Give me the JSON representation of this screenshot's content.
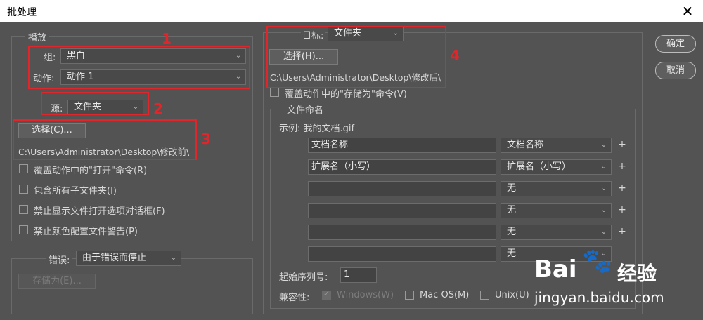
{
  "window": {
    "title": "批处理",
    "close_glyph": "✕"
  },
  "play": {
    "legend": "播放",
    "set_label": "组:",
    "set_value": "黑白",
    "action_label": "动作:",
    "action_value": "动作 1",
    "source_label": "源:",
    "source_value": "文件夹",
    "choose_button": "选择(C)...",
    "source_path": "C:\\Users\\Administrator\\Desktop\\修改前\\",
    "options": [
      "覆盖动作中的\"打开\"命令(R)",
      "包含所有子文件夹(I)",
      "禁止显示文件打开选项对话框(F)",
      "禁止颜色配置文件警告(P)"
    ],
    "errors_label": "错误:",
    "errors_value": "由于错误而停止",
    "save_as_button": "存储为(E)..."
  },
  "destination": {
    "label": "目标:",
    "value": "文件夹",
    "choose_button": "选择(H)...",
    "path": "C:\\Users\\Administrator\\Desktop\\修改后\\",
    "override_save": "覆盖动作中的\"存储为\"命令(V)"
  },
  "naming": {
    "legend": "文件命名",
    "example": "示例: 我的文档.gif",
    "rows": [
      {
        "text": "文档名称",
        "select": "文档名称"
      },
      {
        "text": "扩展名（小写）",
        "select": "扩展名（小写）"
      },
      {
        "text": "",
        "select": "无"
      },
      {
        "text": "",
        "select": "无"
      },
      {
        "text": "",
        "select": "无"
      },
      {
        "text": "",
        "select": "无"
      }
    ],
    "plus_glyph": "+",
    "serial_label": "起始序列号:",
    "serial_value": "1",
    "compat_label": "兼容性:",
    "compat_windows": "Windows(W)",
    "compat_mac": "Mac OS(M)",
    "compat_unix": "Unix(U)"
  },
  "buttons": {
    "ok": "确定",
    "cancel": "取消"
  },
  "annotations": {
    "n1": "1",
    "n2": "2",
    "n3": "3",
    "n4": "4"
  },
  "watermark": {
    "brand": "Bai",
    "brand2": "经验",
    "url": "jingyan.baidu.com"
  },
  "colors": {
    "annotation_red": "#e0262a",
    "dialog_bg": "#535353"
  }
}
